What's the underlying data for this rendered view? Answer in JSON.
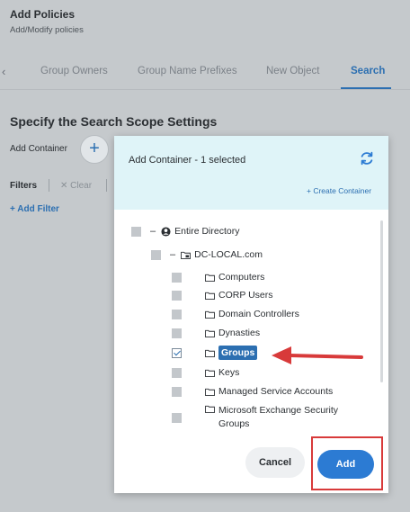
{
  "header": {
    "title": "Add Policies",
    "subtitle": "Add/Modify policies"
  },
  "tabs": {
    "items": [
      {
        "label": "Group Owners"
      },
      {
        "label": "Group Name Prefixes"
      },
      {
        "label": "New Object"
      },
      {
        "label": "Search"
      }
    ],
    "active": "Search",
    "back_icon": "chevron-left-icon"
  },
  "scope": {
    "title": "Specify the Search Scope Settings",
    "add_container_label": "Add Container",
    "add_icon": "plus-icon"
  },
  "filters": {
    "label": "Filters",
    "clear_label": "Clear",
    "add_filter_label": "+ Add Filter"
  },
  "dialog": {
    "title": "Add Container - 1 selected",
    "refresh_icon": "refresh-icon",
    "create_link": "+ Create Container",
    "tree": {
      "root": "Entire Directory",
      "domain": "DC-LOCAL.com",
      "items": [
        {
          "label": "Computers",
          "checked": false
        },
        {
          "label": "CORP Users",
          "checked": false
        },
        {
          "label": "Domain Controllers",
          "checked": false
        },
        {
          "label": "Dynasties",
          "checked": false
        },
        {
          "label": "Groups",
          "checked": true
        },
        {
          "label": "Keys",
          "checked": false
        },
        {
          "label": "Managed Service Accounts",
          "checked": false
        },
        {
          "label": "Microsoft Exchange Security Groups",
          "checked": false
        }
      ]
    },
    "cancel_label": "Cancel",
    "add_label": "Add"
  },
  "colors": {
    "accent": "#2c6fb1",
    "annotation": "#d83a3a",
    "dialog_header": "#dff4f8"
  }
}
